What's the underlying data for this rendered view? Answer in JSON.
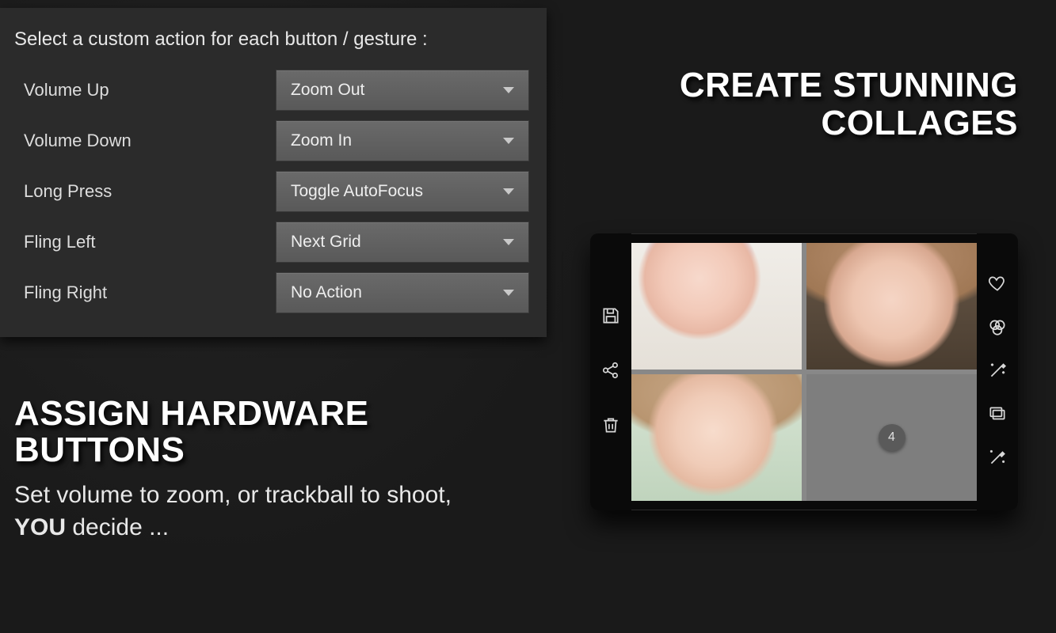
{
  "settings": {
    "title": "Select a custom action for each button / gesture :",
    "rows": [
      {
        "label": "Volume Up",
        "value": "Zoom Out"
      },
      {
        "label": "Volume Down",
        "value": "Zoom In"
      },
      {
        "label": "Long Press",
        "value": "Toggle AutoFocus"
      },
      {
        "label": "Fling Left",
        "value": "Next Grid"
      },
      {
        "label": "Fling Right",
        "value": "No Action"
      }
    ]
  },
  "left_headline": {
    "title_line1": "ASSIGN HARDWARE",
    "title_line2": "BUTTONS",
    "sub_pre": "Set volume to zoom, or trackball to shoot, ",
    "sub_strong": "YOU",
    "sub_post": " decide ..."
  },
  "right_headline": {
    "line1": "CREATE STUNNING",
    "line2": "COLLAGES"
  },
  "collage": {
    "empty_slot_number": "4",
    "left_icons": [
      "save-icon",
      "share-icon",
      "trash-icon"
    ],
    "right_icons": [
      "heart-icon",
      "filters-icon",
      "magic-wand-icon",
      "layers-icon",
      "customize-icon"
    ]
  }
}
